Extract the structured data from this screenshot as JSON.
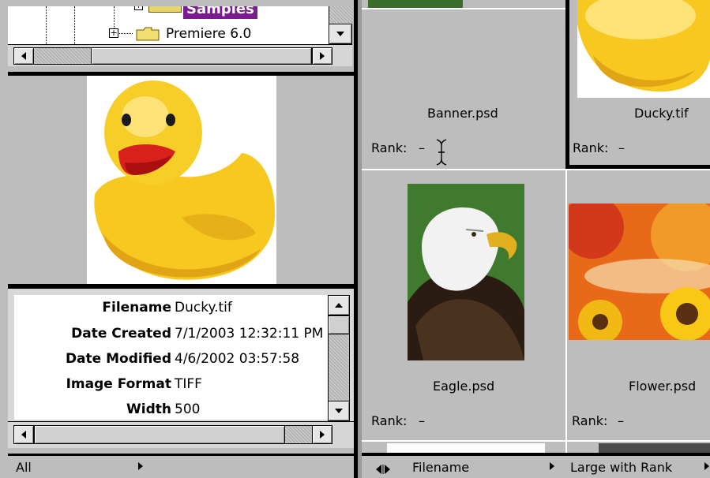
{
  "folders": {
    "items": [
      {
        "label": "Samples",
        "selected": true
      },
      {
        "label": "Premiere 6.0",
        "selected": false
      }
    ]
  },
  "metadata": {
    "rows": [
      {
        "key": "Filename",
        "value": "Ducky.tif"
      },
      {
        "key": "Date Created",
        "value": "7/1/2003 12:32:11 PM"
      },
      {
        "key": "Date Modified",
        "value": "4/6/2002 03:57:58"
      },
      {
        "key": "Image Format",
        "value": "TIFF"
      },
      {
        "key": "Width",
        "value": "500"
      }
    ]
  },
  "left_status": {
    "filter": "All"
  },
  "thumbs": [
    {
      "name": "Banner.psd",
      "rank_label": "Rank:",
      "rank": "–"
    },
    {
      "name": "Ducky.tif",
      "rank_label": "Rank:",
      "rank": "–"
    },
    {
      "name": "Eagle.psd",
      "rank_label": "Rank:",
      "rank": "–"
    },
    {
      "name": "Flower.psd",
      "rank_label": "Rank:",
      "rank": "–"
    }
  ],
  "right_status": {
    "sort": "Filename",
    "view": "Large with Rank"
  },
  "colors": {
    "selection": "#7a1c8f",
    "background": "#bdbdbd",
    "black": "#000000"
  },
  "icons": [
    "expand-plus-icon",
    "folder-icon",
    "scroll-arrow-icon",
    "text-cursor-icon",
    "panel-toggle-icon",
    "menu-arrow-icon"
  ]
}
